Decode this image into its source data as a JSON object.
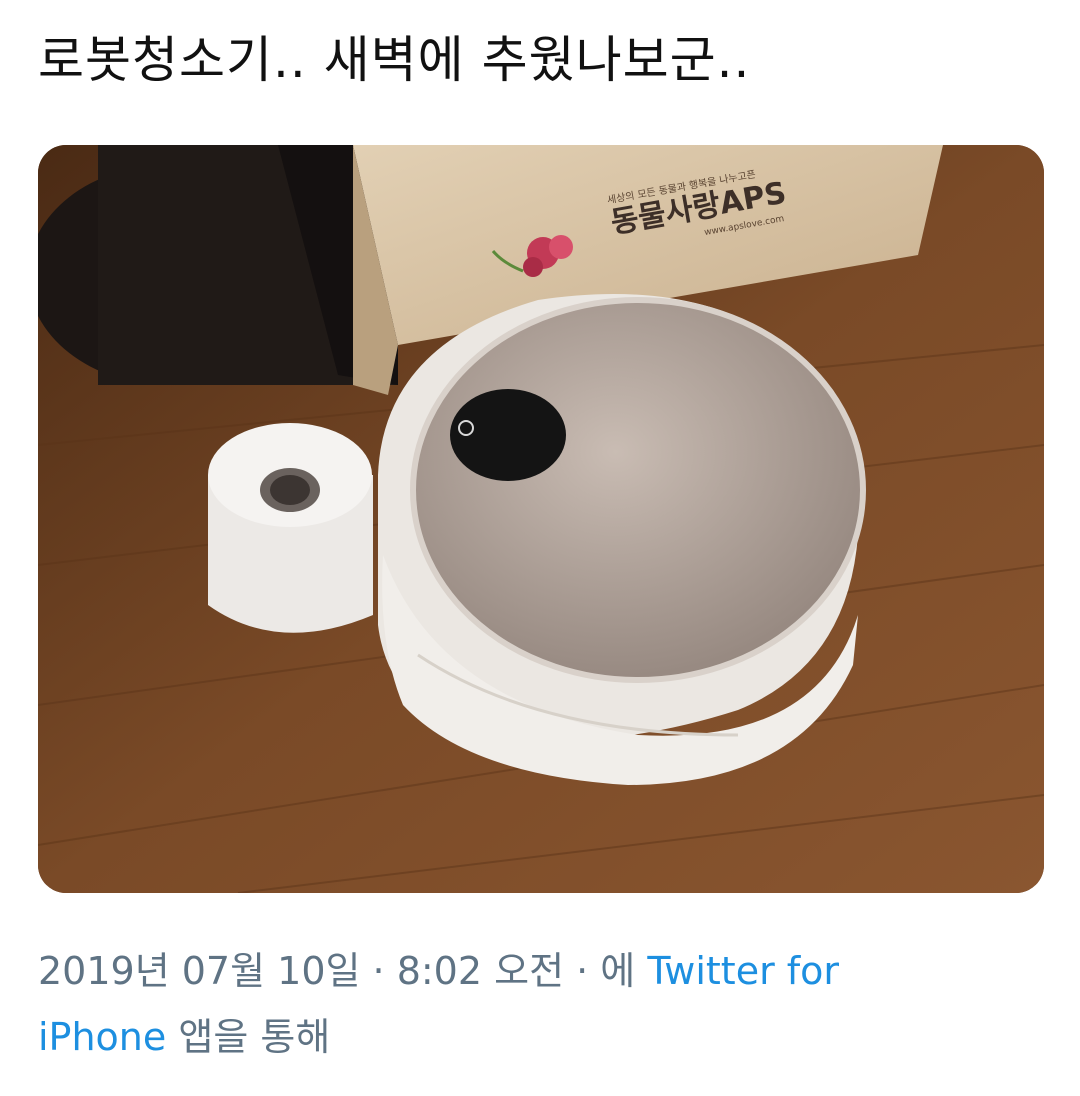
{
  "tweet": {
    "text": "로봇청소기.. 새벽에 추웠나보군..",
    "media": {
      "box_brand_small": "세상의 모든 동물과 행복을 나누고픈",
      "box_brand_main": "동물사랑APS",
      "box_url": "www.apslove.com"
    },
    "meta": {
      "date": "2019년 07월 10일",
      "separator": " · ",
      "time": "8:02 오전",
      "via_prefix": "에 ",
      "source_part1": "Twitter for",
      "source_part2": "iPhone",
      "via_suffix": " 앱을 통해"
    }
  },
  "colors": {
    "text": "#111111",
    "meta": "#5f7384",
    "link": "#1d8fe0",
    "floor": "#6b3f22",
    "box": "#d8c3a5"
  }
}
